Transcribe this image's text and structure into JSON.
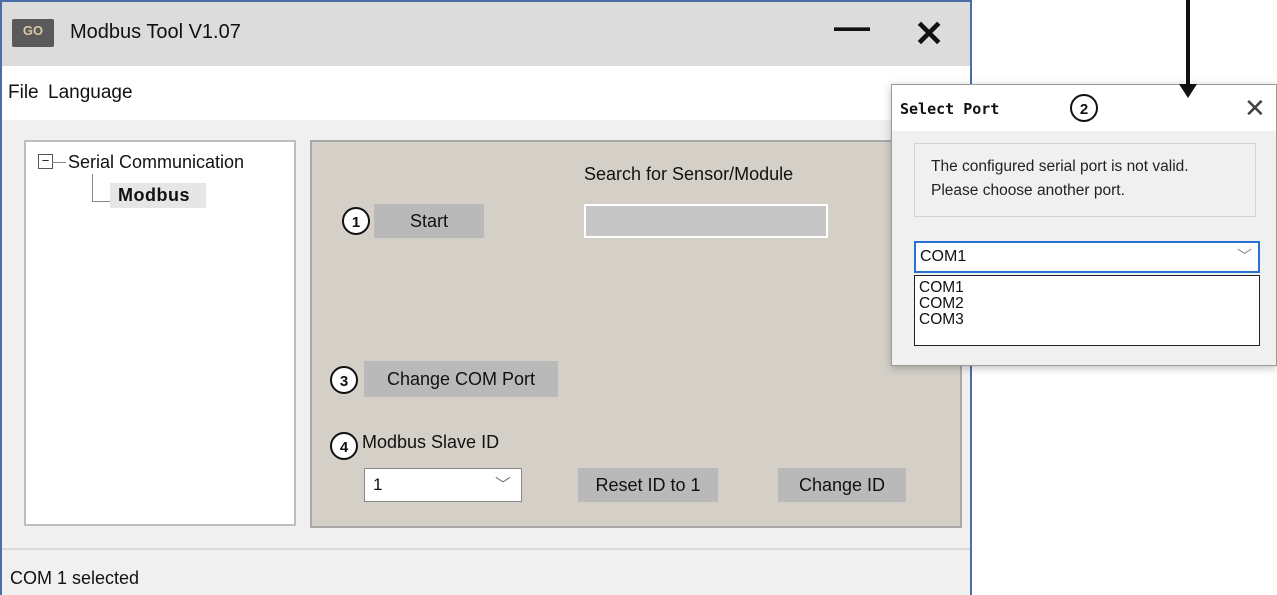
{
  "window": {
    "title": "Modbus Tool V1.07",
    "logo_text": "GO",
    "minimize_glyph": "—",
    "close_glyph": "✕"
  },
  "menu": {
    "file": "File",
    "language": "Language"
  },
  "tree": {
    "toggle": "−",
    "root": "Serial Communication",
    "child": "Modbus"
  },
  "panel": {
    "search_label": "Search for Sensor/Module",
    "start": "Start",
    "change_com": "Change COM Port",
    "slave_label": "Modbus Slave ID",
    "slave_id_value": "1",
    "reset_id": "Reset ID to 1",
    "change_id": "Change ID"
  },
  "markers": {
    "one": "1",
    "two": "2",
    "three": "3",
    "four": "4"
  },
  "status": {
    "text": "COM 1 selected"
  },
  "dialog": {
    "title": "Select Port",
    "close_glyph": "✕",
    "message_line1": "The configured serial port is not valid.",
    "message_line2": "Please choose another port.",
    "selected_port": "COM1",
    "options": [
      "COM1",
      "COM2",
      "COM3"
    ]
  },
  "icons": {
    "dropdown": "chevron-down-icon",
    "arrow": "down-arrow-icon"
  },
  "colors": {
    "titlebar": "#dcdcdc",
    "panel": "#d4d0c8",
    "button": "#b9b9b9",
    "focus": "#2a72d2"
  }
}
